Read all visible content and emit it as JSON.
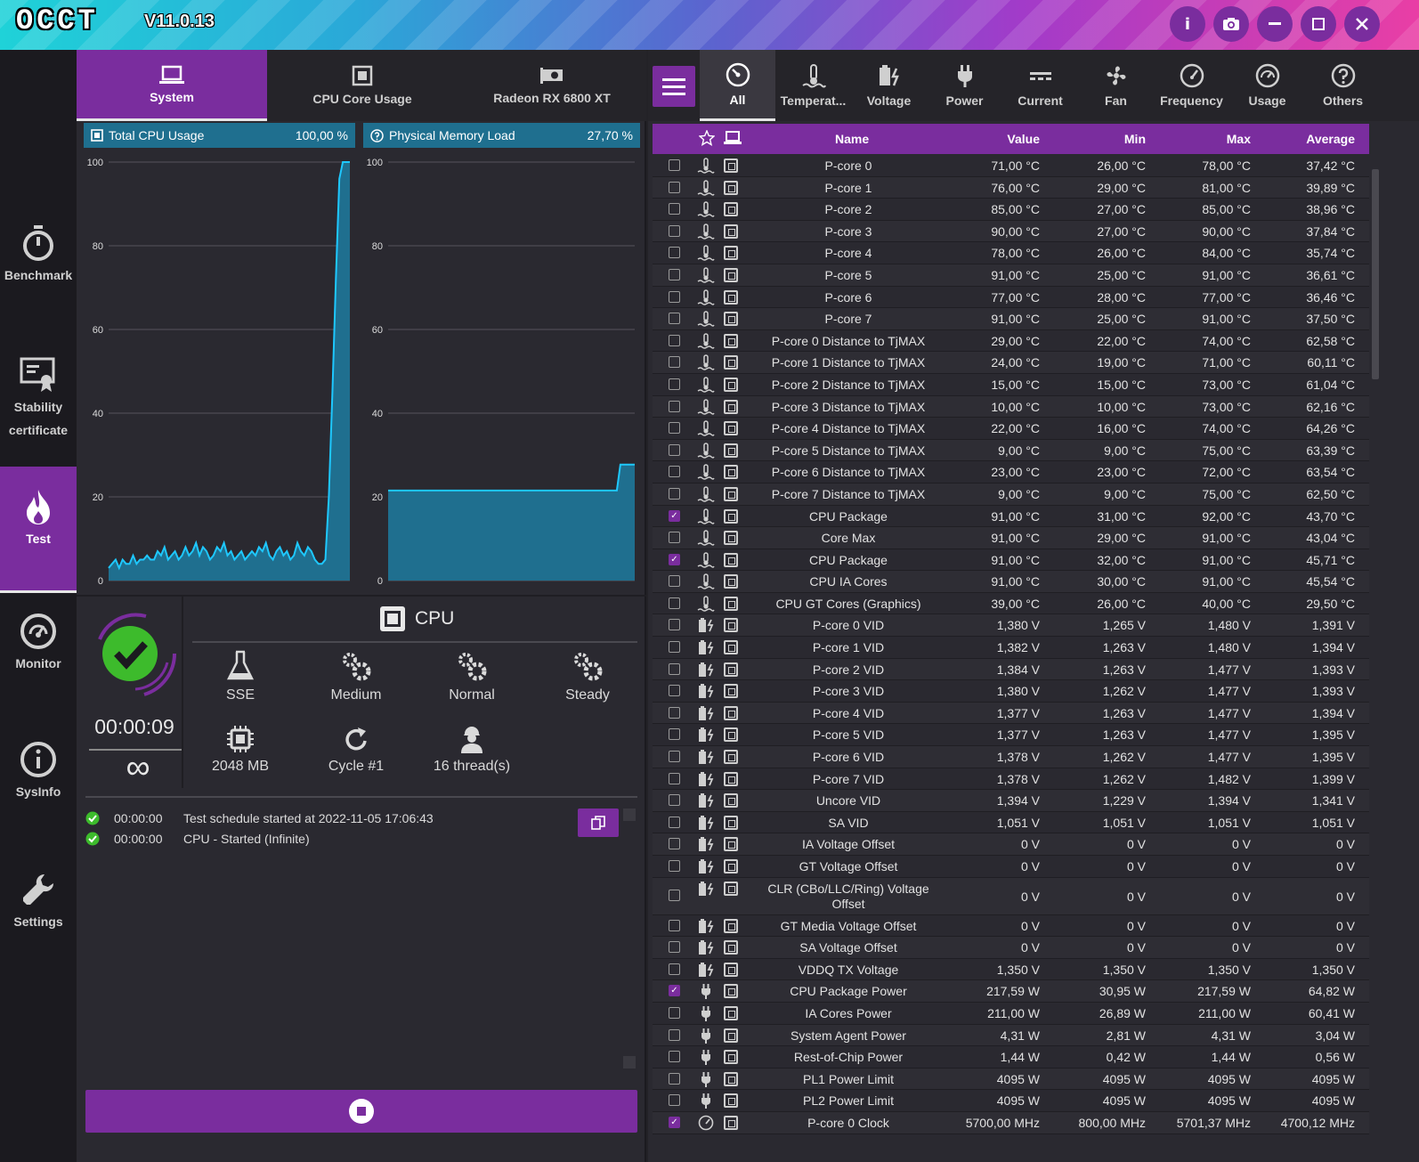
{
  "app": {
    "logo": "OCCT",
    "version": "V11.0.13"
  },
  "window_buttons": [
    "info-icon",
    "camera-icon",
    "minimize-icon",
    "maximize-icon",
    "close-icon"
  ],
  "sidebar": {
    "items": [
      {
        "label": "Benchmark",
        "icon": "stopwatch-icon"
      },
      {
        "label": "Stability certificate",
        "icon": "certificate-icon"
      },
      {
        "label": "Test",
        "icon": "flame-icon",
        "active": true
      },
      {
        "label": "Monitor",
        "icon": "gauge-icon"
      },
      {
        "label": "SysInfo",
        "icon": "info-icon"
      },
      {
        "label": "Settings",
        "icon": "wrench-icon"
      }
    ]
  },
  "graph_tabs": [
    {
      "label": "System",
      "icon": "laptop-icon",
      "active": true
    },
    {
      "label": "CPU Core Usage",
      "icon": "cpu-icon"
    },
    {
      "label": "Radeon RX 6800 XT",
      "icon": "gpu-icon"
    }
  ],
  "charts": {
    "cpu": {
      "title": "Total CPU Usage",
      "value": "100,00 %"
    },
    "mem": {
      "title": "Physical Memory Load",
      "value": "27,70 %"
    }
  },
  "chart_data": [
    {
      "type": "area",
      "title": "Total CPU Usage",
      "ylim": [
        0,
        100
      ],
      "yticks": [
        "100",
        "80",
        "60",
        "40",
        "20",
        "0"
      ],
      "grid": true,
      "values": [
        3,
        4,
        5,
        3,
        5,
        4,
        4,
        6,
        4,
        5,
        5,
        6,
        5,
        5,
        7,
        6,
        8,
        5,
        6,
        7,
        5,
        6,
        8,
        6,
        7,
        9,
        6,
        8,
        7,
        5,
        6,
        8,
        7,
        9,
        6,
        7,
        5,
        6,
        7,
        5,
        6,
        7,
        6,
        8,
        7,
        9,
        6,
        5,
        7,
        8,
        6,
        7,
        5,
        6,
        9,
        7,
        6,
        8,
        7,
        5,
        4,
        4,
        5,
        20,
        45,
        72,
        96,
        100,
        100,
        100
      ]
    },
    {
      "type": "area",
      "title": "Physical Memory Load",
      "ylim": [
        0,
        100
      ],
      "yticks": [
        "100",
        "80",
        "60",
        "40",
        "20",
        "0"
      ],
      "grid": true,
      "values": [
        21.5,
        21.5,
        21.5,
        21.5,
        21.5,
        21.5,
        21.5,
        21.5,
        21.5,
        21.5,
        21.5,
        21.5,
        21.5,
        21.5,
        21.5,
        21.5,
        21.5,
        21.5,
        21.5,
        21.5,
        21.5,
        21.5,
        21.5,
        21.5,
        21.5,
        21.5,
        21.5,
        21.5,
        21.5,
        21.5,
        21.5,
        21.5,
        21.5,
        21.5,
        21.5,
        21.5,
        21.5,
        21.5,
        21.5,
        21.5,
        21.5,
        21.5,
        21.5,
        21.5,
        21.5,
        21.5,
        21.5,
        21.5,
        21.5,
        21.5,
        21.5,
        21.5,
        21.5,
        21.5,
        21.5,
        21.5,
        21.5,
        21.5,
        21.5,
        21.5,
        21.5,
        21.5,
        21.5,
        21.5,
        21.5,
        27.7,
        27.7,
        27.7,
        27.7,
        27.7
      ]
    }
  ],
  "status": {
    "timer": "00:00:09",
    "duration_symbol": "∞",
    "test_name": "CPU",
    "params": [
      {
        "label": "SSE",
        "icon": "flask-icon"
      },
      {
        "label": "Medium",
        "icon": "gears-icon"
      },
      {
        "label": "Normal",
        "icon": "gears-icon"
      },
      {
        "label": "Steady",
        "icon": "gears-icon"
      },
      {
        "label": "2048 MB",
        "icon": "chip-icon"
      },
      {
        "label": "Cycle #1",
        "icon": "refresh-icon"
      },
      {
        "label": "16 thread(s)",
        "icon": "worker-icon"
      }
    ]
  },
  "log": [
    {
      "time": "00:00:00",
      "text": "Test schedule started at 2022-11-05 17:06:43"
    },
    {
      "time": "00:00:00",
      "text": "CPU - Started (Infinite)"
    }
  ],
  "category_tabs": [
    {
      "label": "All",
      "icon": "dial-icon",
      "active": true
    },
    {
      "label": "Temperat...",
      "icon": "thermometer-icon"
    },
    {
      "label": "Voltage",
      "icon": "battery-icon"
    },
    {
      "label": "Power",
      "icon": "plug-icon"
    },
    {
      "label": "Current",
      "icon": "current-icon"
    },
    {
      "label": "Fan",
      "icon": "fan-icon"
    },
    {
      "label": "Frequency",
      "icon": "speedometer-icon"
    },
    {
      "label": "Usage",
      "icon": "usage-icon"
    },
    {
      "label": "Others",
      "icon": "question-icon"
    }
  ],
  "table": {
    "headers": {
      "name": "Name",
      "value": "Value",
      "min": "Min",
      "max": "Max",
      "avg": "Average"
    },
    "rows": [
      {
        "c": false,
        "t": "temp",
        "n": "P-core 0",
        "v": "71,00 °C",
        "mi": "26,00 °C",
        "ma": "78,00 °C",
        "a": "37,42 °C"
      },
      {
        "c": false,
        "t": "temp",
        "n": "P-core 1",
        "v": "76,00 °C",
        "mi": "29,00 °C",
        "ma": "81,00 °C",
        "a": "39,89 °C"
      },
      {
        "c": false,
        "t": "temp",
        "n": "P-core 2",
        "v": "85,00 °C",
        "mi": "27,00 °C",
        "ma": "85,00 °C",
        "a": "38,96 °C"
      },
      {
        "c": false,
        "t": "temp",
        "n": "P-core 3",
        "v": "90,00 °C",
        "mi": "27,00 °C",
        "ma": "90,00 °C",
        "a": "37,84 °C"
      },
      {
        "c": false,
        "t": "temp",
        "n": "P-core 4",
        "v": "78,00 °C",
        "mi": "26,00 °C",
        "ma": "84,00 °C",
        "a": "35,74 °C"
      },
      {
        "c": false,
        "t": "temp",
        "n": "P-core 5",
        "v": "91,00 °C",
        "mi": "25,00 °C",
        "ma": "91,00 °C",
        "a": "36,61 °C"
      },
      {
        "c": false,
        "t": "temp",
        "n": "P-core 6",
        "v": "77,00 °C",
        "mi": "28,00 °C",
        "ma": "77,00 °C",
        "a": "36,46 °C"
      },
      {
        "c": false,
        "t": "temp",
        "n": "P-core 7",
        "v": "91,00 °C",
        "mi": "25,00 °C",
        "ma": "91,00 °C",
        "a": "37,50 °C"
      },
      {
        "c": false,
        "t": "temp",
        "n": "P-core 0 Distance to TjMAX",
        "v": "29,00 °C",
        "mi": "22,00 °C",
        "ma": "74,00 °C",
        "a": "62,58 °C"
      },
      {
        "c": false,
        "t": "temp",
        "n": "P-core 1 Distance to TjMAX",
        "v": "24,00 °C",
        "mi": "19,00 °C",
        "ma": "71,00 °C",
        "a": "60,11 °C"
      },
      {
        "c": false,
        "t": "temp",
        "n": "P-core 2 Distance to TjMAX",
        "v": "15,00 °C",
        "mi": "15,00 °C",
        "ma": "73,00 °C",
        "a": "61,04 °C"
      },
      {
        "c": false,
        "t": "temp",
        "n": "P-core 3 Distance to TjMAX",
        "v": "10,00 °C",
        "mi": "10,00 °C",
        "ma": "73,00 °C",
        "a": "62,16 °C"
      },
      {
        "c": false,
        "t": "temp",
        "n": "P-core 4 Distance to TjMAX",
        "v": "22,00 °C",
        "mi": "16,00 °C",
        "ma": "74,00 °C",
        "a": "64,26 °C"
      },
      {
        "c": false,
        "t": "temp",
        "n": "P-core 5 Distance to TjMAX",
        "v": "9,00 °C",
        "mi": "9,00 °C",
        "ma": "75,00 °C",
        "a": "63,39 °C"
      },
      {
        "c": false,
        "t": "temp",
        "n": "P-core 6 Distance to TjMAX",
        "v": "23,00 °C",
        "mi": "23,00 °C",
        "ma": "72,00 °C",
        "a": "63,54 °C"
      },
      {
        "c": false,
        "t": "temp",
        "n": "P-core 7 Distance to TjMAX",
        "v": "9,00 °C",
        "mi": "9,00 °C",
        "ma": "75,00 °C",
        "a": "62,50 °C"
      },
      {
        "c": true,
        "t": "temp",
        "n": "CPU Package",
        "v": "91,00 °C",
        "mi": "31,00 °C",
        "ma": "92,00 °C",
        "a": "43,70 °C"
      },
      {
        "c": false,
        "t": "temp",
        "n": "Core Max",
        "v": "91,00 °C",
        "mi": "29,00 °C",
        "ma": "91,00 °C",
        "a": "43,04 °C"
      },
      {
        "c": true,
        "t": "temp",
        "n": "CPU Package",
        "v": "91,00 °C",
        "mi": "32,00 °C",
        "ma": "91,00 °C",
        "a": "45,71 °C"
      },
      {
        "c": false,
        "t": "temp",
        "n": "CPU IA Cores",
        "v": "91,00 °C",
        "mi": "30,00 °C",
        "ma": "91,00 °C",
        "a": "45,54 °C"
      },
      {
        "c": false,
        "t": "temp",
        "n": "CPU GT Cores (Graphics)",
        "v": "39,00 °C",
        "mi": "26,00 °C",
        "ma": "40,00 °C",
        "a": "29,50 °C"
      },
      {
        "c": false,
        "t": "volt",
        "n": "P-core 0 VID",
        "v": "1,380 V",
        "mi": "1,265 V",
        "ma": "1,480 V",
        "a": "1,391 V"
      },
      {
        "c": false,
        "t": "volt",
        "n": "P-core 1 VID",
        "v": "1,382 V",
        "mi": "1,263 V",
        "ma": "1,480 V",
        "a": "1,394 V"
      },
      {
        "c": false,
        "t": "volt",
        "n": "P-core 2 VID",
        "v": "1,384 V",
        "mi": "1,263 V",
        "ma": "1,477 V",
        "a": "1,393 V"
      },
      {
        "c": false,
        "t": "volt",
        "n": "P-core 3 VID",
        "v": "1,380 V",
        "mi": "1,262 V",
        "ma": "1,477 V",
        "a": "1,393 V"
      },
      {
        "c": false,
        "t": "volt",
        "n": "P-core 4 VID",
        "v": "1,377 V",
        "mi": "1,263 V",
        "ma": "1,477 V",
        "a": "1,394 V"
      },
      {
        "c": false,
        "t": "volt",
        "n": "P-core 5 VID",
        "v": "1,377 V",
        "mi": "1,263 V",
        "ma": "1,477 V",
        "a": "1,395 V"
      },
      {
        "c": false,
        "t": "volt",
        "n": "P-core 6 VID",
        "v": "1,378 V",
        "mi": "1,262 V",
        "ma": "1,477 V",
        "a": "1,395 V"
      },
      {
        "c": false,
        "t": "volt",
        "n": "P-core 7 VID",
        "v": "1,378 V",
        "mi": "1,262 V",
        "ma": "1,482 V",
        "a": "1,399 V"
      },
      {
        "c": false,
        "t": "volt",
        "n": "Uncore VID",
        "v": "1,394 V",
        "mi": "1,229 V",
        "ma": "1,394 V",
        "a": "1,341 V"
      },
      {
        "c": false,
        "t": "volt",
        "n": "SA VID",
        "v": "1,051 V",
        "mi": "1,051 V",
        "ma": "1,051 V",
        "a": "1,051 V"
      },
      {
        "c": false,
        "t": "volt",
        "n": "IA Voltage Offset",
        "v": "0 V",
        "mi": "0 V",
        "ma": "0 V",
        "a": "0 V"
      },
      {
        "c": false,
        "t": "volt",
        "n": "GT Voltage Offset",
        "v": "0 V",
        "mi": "0 V",
        "ma": "0 V",
        "a": "0 V"
      },
      {
        "c": false,
        "t": "volt",
        "n": "CLR (CBo/LLC/Ring) Voltage Offset",
        "v": "0 V",
        "mi": "0 V",
        "ma": "0 V",
        "a": "0 V",
        "tall": true
      },
      {
        "c": false,
        "t": "volt",
        "n": "GT Media Voltage Offset",
        "v": "0 V",
        "mi": "0 V",
        "ma": "0 V",
        "a": "0 V"
      },
      {
        "c": false,
        "t": "volt",
        "n": "SA Voltage Offset",
        "v": "0 V",
        "mi": "0 V",
        "ma": "0 V",
        "a": "0 V"
      },
      {
        "c": false,
        "t": "volt",
        "n": "VDDQ TX Voltage",
        "v": "1,350 V",
        "mi": "1,350 V",
        "ma": "1,350 V",
        "a": "1,350 V"
      },
      {
        "c": true,
        "t": "power",
        "n": "CPU Package Power",
        "v": "217,59 W",
        "mi": "30,95 W",
        "ma": "217,59 W",
        "a": "64,82 W"
      },
      {
        "c": false,
        "t": "power",
        "n": "IA Cores Power",
        "v": "211,00 W",
        "mi": "26,89 W",
        "ma": "211,00 W",
        "a": "60,41 W"
      },
      {
        "c": false,
        "t": "power",
        "n": "System Agent Power",
        "v": "4,31 W",
        "mi": "2,81 W",
        "ma": "4,31 W",
        "a": "3,04 W"
      },
      {
        "c": false,
        "t": "power",
        "n": "Rest-of-Chip Power",
        "v": "1,44 W",
        "mi": "0,42 W",
        "ma": "1,44 W",
        "a": "0,56 W"
      },
      {
        "c": false,
        "t": "power",
        "n": "PL1 Power Limit",
        "v": "4095 W",
        "mi": "4095 W",
        "ma": "4095 W",
        "a": "4095 W"
      },
      {
        "c": false,
        "t": "power",
        "n": "PL2 Power Limit",
        "v": "4095 W",
        "mi": "4095 W",
        "ma": "4095 W",
        "a": "4095 W"
      },
      {
        "c": true,
        "t": "freq",
        "n": "P-core 0 Clock",
        "v": "5700,00 MHz",
        "mi": "800,00 MHz",
        "ma": "5701,37 MHz",
        "a": "4700,12 MHz"
      }
    ]
  },
  "colors": {
    "accent": "#7a2d9e",
    "chart_line": "#1ec8ff",
    "chart_fill": "#1f6f8f",
    "ok_green": "#3dbb2c"
  }
}
